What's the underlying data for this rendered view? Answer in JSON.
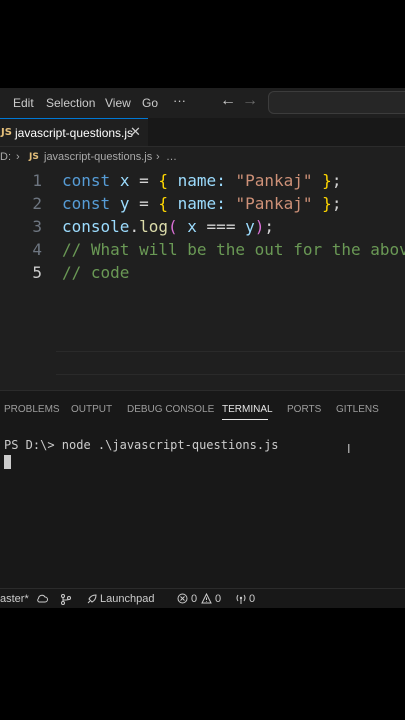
{
  "menu": {
    "edit": "Edit",
    "selection": "Selection",
    "view": "View",
    "go": "Go",
    "more": "···"
  },
  "nav": {
    "back": "←",
    "forward": "→"
  },
  "tab": {
    "icon_text": "JS",
    "filename": "javascript-questions.js",
    "close": "✕"
  },
  "breadcrumb": {
    "drive": "D:",
    "separator": "›",
    "icon_text": "JS",
    "file": "javascript-questions.js",
    "more": "…"
  },
  "editor": {
    "line_numbers": [
      "1",
      "2",
      "3",
      "4",
      "5"
    ],
    "active_line": "5",
    "line1": {
      "kw": "const",
      "var": "x",
      "eq": "=",
      "open": "{",
      "prop": "name:",
      "str": "\"Pankaj\"",
      "close": "}",
      "semi": ";"
    },
    "line2": {
      "kw": "const",
      "var": "y",
      "eq": "=",
      "open": "{",
      "prop": "name:",
      "str": "\"Pankaj\"",
      "close": "}",
      "semi": ";"
    },
    "line3": {
      "obj": "console",
      "dot": ".",
      "fn": "log",
      "open": "(",
      "a": "x",
      "op": "===",
      "b": "y",
      "close": ")",
      "semi": ";"
    },
    "line4": "// What will be the out for the abov",
    "line5": "// code"
  },
  "panel": {
    "tabs": [
      "PROBLEMS",
      "OUTPUT",
      "DEBUG CONSOLE",
      "TERMINAL",
      "PORTS",
      "GITLENS"
    ],
    "active_tab": "TERMINAL",
    "terminal_line": "PS D:\\> node .\\javascript-questions.js",
    "ibeam": "I"
  },
  "status": {
    "branch": "aster*",
    "launchpad": "Launchpad",
    "errors": "0",
    "warnings": "0",
    "ports": "0"
  },
  "colors": {
    "accent": "#0078d4",
    "keyword": "#569cd6",
    "string": "#ce9178",
    "comment": "#6a9955"
  }
}
